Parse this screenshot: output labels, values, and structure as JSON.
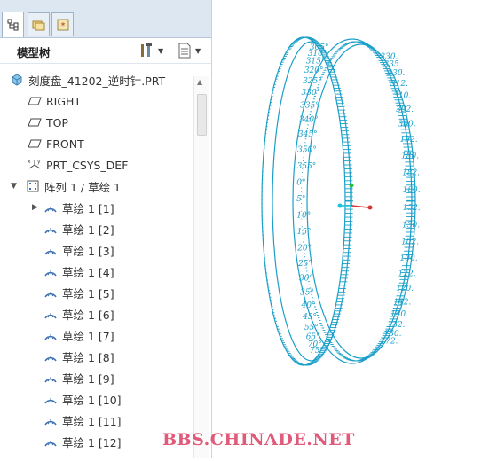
{
  "tabs": [
    {
      "name": "model-tree-tab",
      "icon": "model-tree-icon"
    },
    {
      "name": "folder-browser-tab",
      "icon": "folder-icon"
    },
    {
      "name": "favorites-tab",
      "icon": "favorites-icon"
    }
  ],
  "panel": {
    "title": "模型树",
    "tools_icon": "settings-tools-icon",
    "show_icon": "show-list-icon"
  },
  "tree": {
    "root": "刻度盘_41202_逆时针.PRT",
    "datums": [
      "RIGHT",
      "TOP",
      "FRONT"
    ],
    "csys": "PRT_CSYS_DEF",
    "pattern": "阵列 1 / 草绘 1",
    "sketches": [
      "草绘 1 [1]",
      "草绘 1 [2]",
      "草绘 1 [3]",
      "草绘 1 [4]",
      "草绘 1 [5]",
      "草绘 1 [6]",
      "草绘 1 [7]",
      "草绘 1 [8]",
      "草绘 1 [9]",
      "草绘 1 [10]",
      "草绘 1 [11]",
      "草绘 1 [12]"
    ]
  },
  "model": {
    "left_labels": [
      "305°",
      "310°",
      "315°",
      "320°",
      "325°",
      "330°",
      "335°",
      "340°",
      "345°",
      "350°",
      "355°",
      "0°",
      "5°",
      "10°",
      "15°",
      "20°",
      "25°",
      "30°",
      "35°",
      "40°",
      "45°",
      "55°",
      "65°",
      "70°",
      "75°"
    ],
    "right_labels": [
      "330.",
      "335.",
      "330.",
      "312.",
      "310.",
      "302.",
      "300.",
      "192.",
      "180.",
      "182.",
      "180.",
      "132.",
      "130.",
      "102.",
      "100.",
      "122.",
      "120.",
      "142.",
      "140.",
      "132.",
      "130.",
      "172."
    ],
    "ring_color": "#1a9fc9"
  },
  "watermark": "BBS.CHINADE.NET"
}
